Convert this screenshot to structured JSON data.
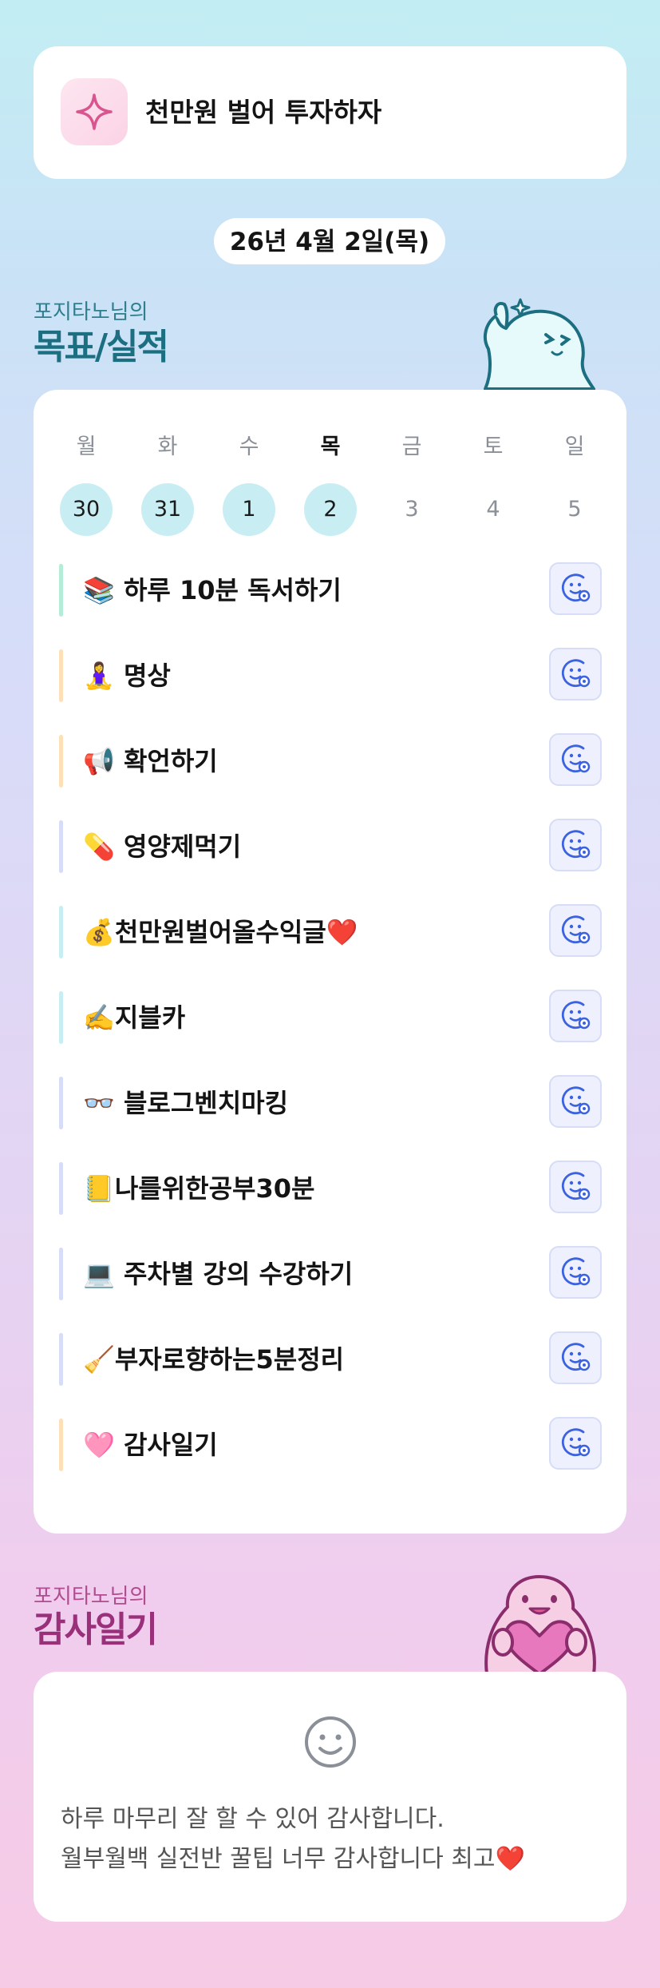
{
  "goal": {
    "text": "천만원 벌어 투자하자",
    "icon": "sparkle-star-icon"
  },
  "date": "26년 4월 2일(목)",
  "goals_section": {
    "subtitle": "포지타노님의",
    "title": "목표/실적"
  },
  "week": [
    {
      "label": "월",
      "day": "30",
      "done": true
    },
    {
      "label": "화",
      "day": "31",
      "done": true
    },
    {
      "label": "수",
      "day": "1",
      "done": true
    },
    {
      "label": "목",
      "day": "2",
      "done": true,
      "today": true
    },
    {
      "label": "금",
      "day": "3",
      "done": false
    },
    {
      "label": "토",
      "day": "4",
      "done": false
    },
    {
      "label": "일",
      "day": "5",
      "done": false
    }
  ],
  "habits": [
    {
      "text": "📚 하루 10분 독서하기",
      "accent": "#b5ecd8"
    },
    {
      "text": "🧘‍♀️ 명상",
      "accent": "#fde0b8"
    },
    {
      "text": "📢 확언하기",
      "accent": "#fde0b8"
    },
    {
      "text": "💊 영양제먹기",
      "accent": "#d7dcf7"
    },
    {
      "text": "💰천만원벌어올수익글❤️",
      "accent": "#c8eef4"
    },
    {
      "text": "✍️지블카",
      "accent": "#c8eef4"
    },
    {
      "text": "👓 블로그벤치마킹",
      "accent": "#d7dcf7"
    },
    {
      "text": "📒나를위한공부30분",
      "accent": "#d7dcf7"
    },
    {
      "text": "💻 주차별 강의 수강하기",
      "accent": "#d7dcf7"
    },
    {
      "text": "🧹부자로향하는5분정리",
      "accent": "#d7dcf7"
    },
    {
      "text": "🩷 감사일기",
      "accent": "#fde0b8"
    }
  ],
  "habit_button_icon": "smiley-add-icon",
  "thanks_section": {
    "subtitle": "포지타노님의",
    "title": "감사일기"
  },
  "thanks": {
    "icon": "smiley-icon",
    "lines": [
      "하루 마무리 잘 할 수 있어 감사합니다.",
      "월부월백 실전반 꿀팁 너무 감사합니다 최고❤️"
    ]
  },
  "colors": {
    "accent_blue": "#3b62e0",
    "teal_title": "#1b6f80",
    "pink_title": "#9a2f7a"
  }
}
